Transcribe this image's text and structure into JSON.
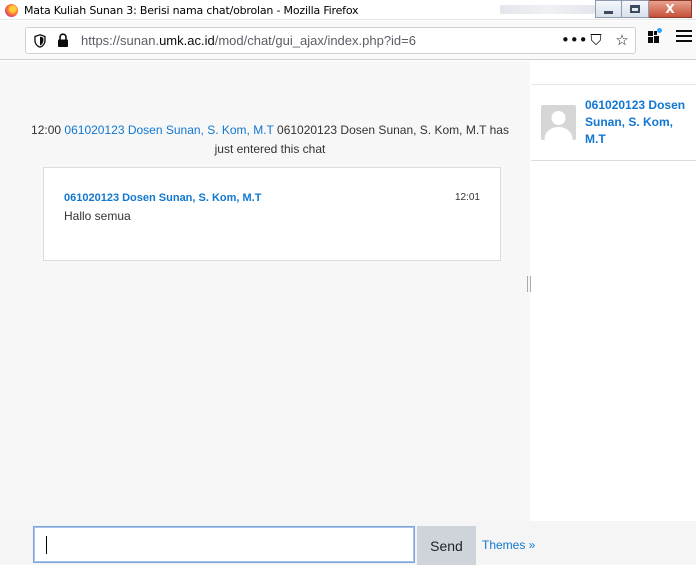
{
  "window": {
    "title": "Mata Kuliah Sunan 3: Berisi nama chat/obrolan - Mozilla Firefox",
    "controls": {
      "minimize_icon": "minimize-icon",
      "maximize_icon": "maximize-icon",
      "close_label": "X"
    }
  },
  "browser": {
    "url_prefix": "https://sunan.",
    "url_domain": "umk.ac.id",
    "url_path": "/mod/chat/gui_ajax/index.php?id=6",
    "page_actions": [
      "•••",
      "⛉",
      "☆"
    ],
    "icons": [
      "shield-icon",
      "lock-icon",
      "extensions-icon",
      "hamburger-menu-icon"
    ]
  },
  "chat": {
    "system_message": {
      "time": "12:00",
      "user_link": "061020123 Dosen Sunan, S. Kom, M.T",
      "rest": "061020123 Dosen Sunan, S. Kom, M.T has just entered this chat"
    },
    "messages": [
      {
        "author": "061020123 Dosen Sunan, S. Kom, M.T",
        "time": "12:01",
        "text": "Hallo semua"
      }
    ]
  },
  "users": [
    {
      "name": "061020123 Dosen Sunan, S. Kom, M.T",
      "avatar": "default-user-avatar"
    }
  ],
  "composer": {
    "input_value": "",
    "send_label": "Send",
    "themes_label": "Themes »"
  },
  "colors": {
    "link": "#1177d1",
    "chat_bg": "#f7f7f7",
    "send_bg": "#ced4da"
  }
}
